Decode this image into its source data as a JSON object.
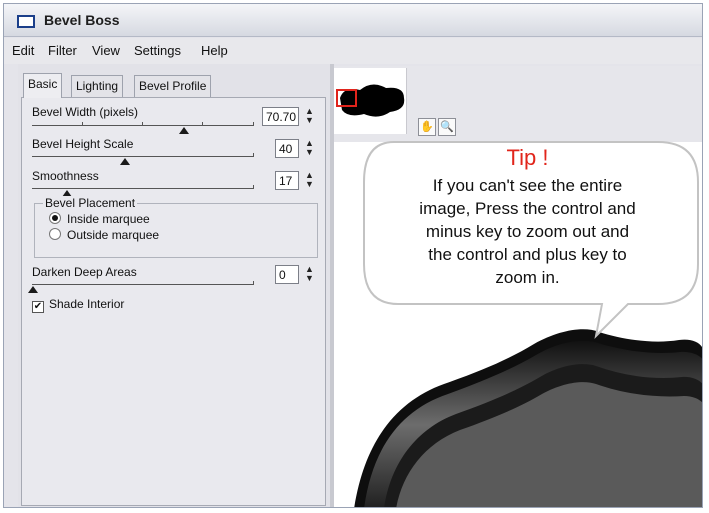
{
  "window": {
    "title": "Bevel Boss"
  },
  "menu": [
    "Edit",
    "Filter",
    "View",
    "Settings",
    "Help"
  ],
  "tabs": [
    {
      "label": "Basic",
      "active": true
    },
    {
      "label": "Lighting",
      "active": false
    },
    {
      "label": "Bevel Profile",
      "active": false
    }
  ],
  "controls": {
    "bevel_width": {
      "label": "Bevel Width (pixels)",
      "value": "70.70"
    },
    "bevel_height": {
      "label": "Bevel Height Scale",
      "value": "40"
    },
    "smoothness": {
      "label": "Smoothness",
      "value": "17"
    },
    "placement": {
      "title": "Bevel Placement",
      "options": [
        {
          "label": "Inside marquee",
          "selected": true
        },
        {
          "label": "Outside marquee",
          "selected": false
        }
      ]
    },
    "darken": {
      "label": "Darken Deep Areas",
      "value": "0"
    },
    "shade_interior": {
      "label": "Shade Interior",
      "checked": true
    }
  },
  "preview": {
    "tools": [
      "hand-icon",
      "zoom-icon"
    ]
  },
  "tip": {
    "title": "Tip !",
    "lines": [
      "If you can't see the entire",
      "image, Press the control and",
      "minus key to zoom out and",
      "the control and plus key to",
      "zoom in."
    ]
  },
  "colors": {
    "tip_title": "#e1251b",
    "thumb_marker": "#e0241c",
    "window_bg": "#e4e4ea"
  }
}
